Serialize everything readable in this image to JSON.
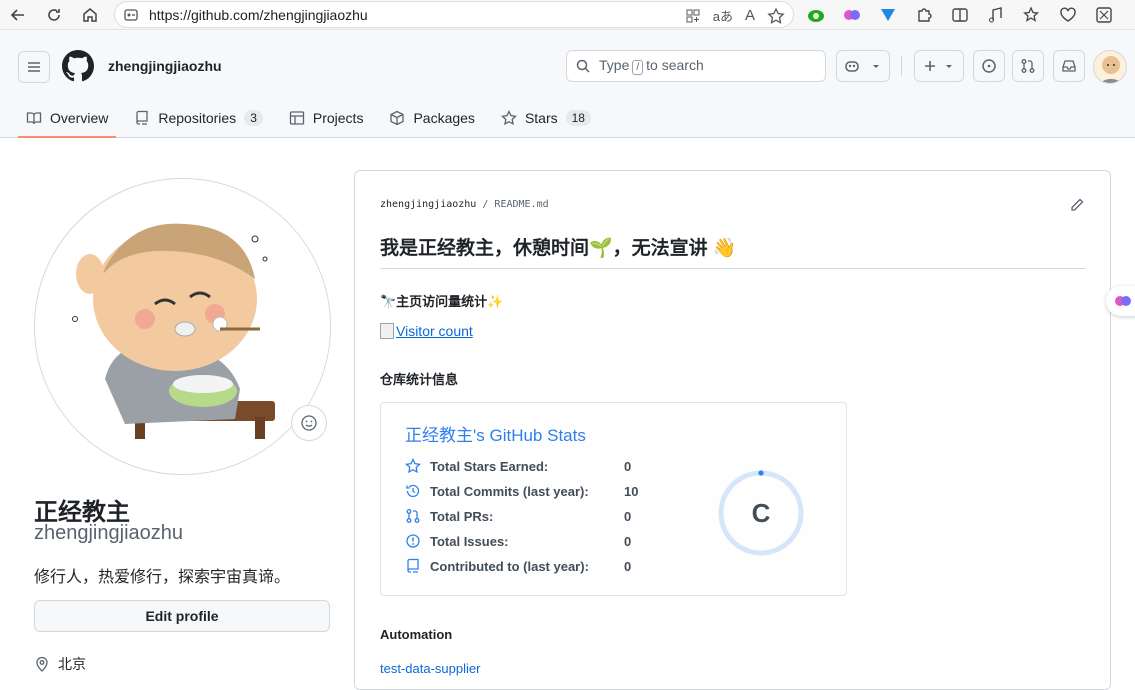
{
  "browser": {
    "url": "https://github.com/zhengjingjiaozhu",
    "read_aloud_glyph": "A",
    "translate_glyph": "aあ"
  },
  "header": {
    "username": "zhengjingjiaozhu",
    "search_prefix": "Type",
    "search_key": "/",
    "search_suffix": "to search"
  },
  "tabs": [
    {
      "label": "Overview"
    },
    {
      "label": "Repositories",
      "count": "3"
    },
    {
      "label": "Projects"
    },
    {
      "label": "Packages"
    },
    {
      "label": "Stars",
      "count": "18"
    }
  ],
  "profile": {
    "display_name": "正经教主",
    "login": "zhengjingjiaozhu",
    "bio": "修行人，热爱修行，探索宇宙真谛。",
    "edit_label": "Edit profile",
    "location": "北京"
  },
  "readme": {
    "path_user": "zhengjingjiaozhu",
    "path_sep": "/",
    "path_file": "README.md",
    "title": "我是正经教主，休憩时间🌱，无法宣讲 👋",
    "visits_heading": "🔭主页访问量统计✨",
    "visitor_alt": "Visitor count",
    "repo_stats_heading": "仓库统计信息",
    "automation_heading": "Automation",
    "automation_link": "test-data-supplier"
  },
  "stats_card": {
    "title": "正经教主's GitHub Stats",
    "rows": [
      {
        "label": "Total Stars Earned:",
        "value": "0",
        "icon": "star-icon"
      },
      {
        "label": "Total Commits (last year):",
        "value": "10",
        "icon": "history-icon"
      },
      {
        "label": "Total PRs:",
        "value": "0",
        "icon": "pull-request-icon"
      },
      {
        "label": "Total Issues:",
        "value": "0",
        "icon": "issue-icon"
      },
      {
        "label": "Contributed to (last year):",
        "value": "0",
        "icon": "repo-icon"
      }
    ],
    "rank": "C",
    "accent": "#2f80ed",
    "text_color": "#434d58"
  }
}
